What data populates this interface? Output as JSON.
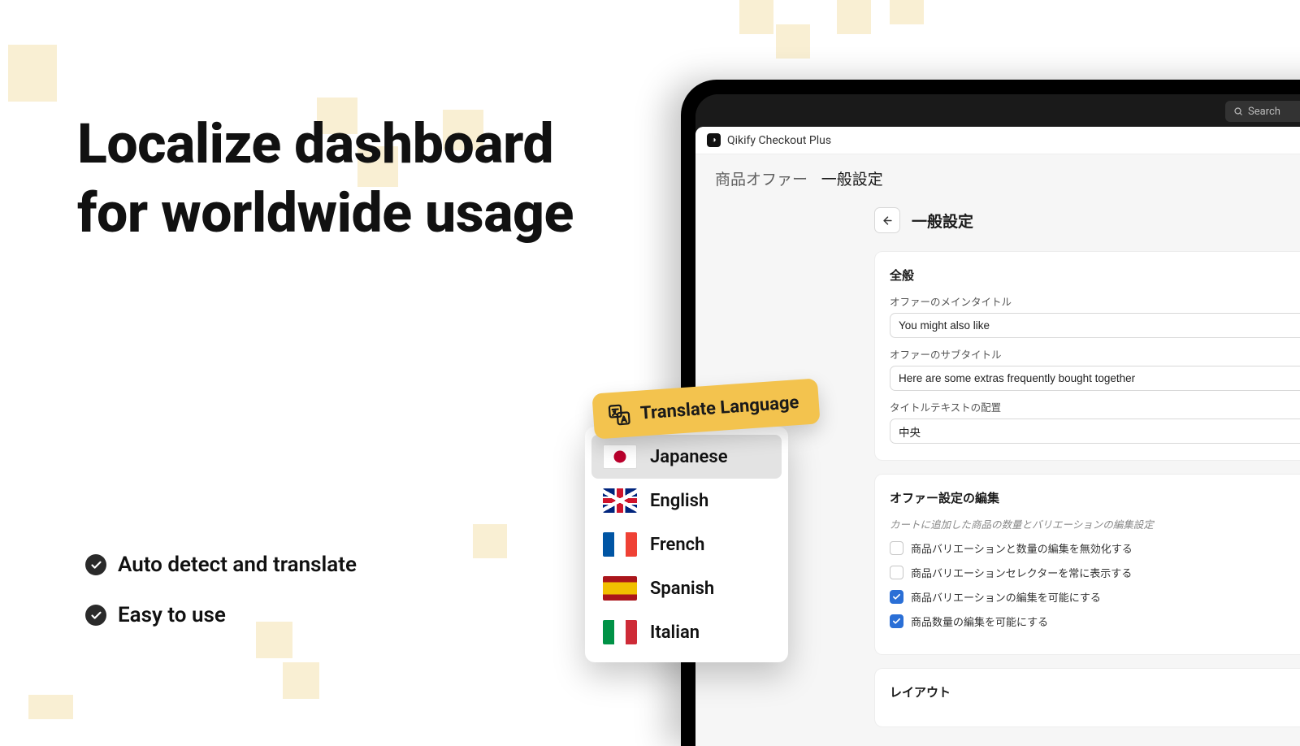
{
  "headline": "Localize dashboard for worldwide usage",
  "bullets": [
    "Auto detect and translate",
    "Easy to use"
  ],
  "translate_tag": "Translate Language",
  "languages": [
    {
      "name": "Japanese",
      "flag": "jp",
      "selected": true
    },
    {
      "name": "English",
      "flag": "uk",
      "selected": false
    },
    {
      "name": "French",
      "flag": "fr",
      "selected": false
    },
    {
      "name": "Spanish",
      "flag": "es",
      "selected": false
    },
    {
      "name": "Italian",
      "flag": "it",
      "selected": false
    }
  ],
  "app": {
    "name": "Qikify Checkout Plus",
    "search_placeholder": "Search",
    "breadcrumb": {
      "parent": "商品オファー",
      "current": "一般設定"
    },
    "page_title": "一般設定",
    "card_general": {
      "title": "全般",
      "main_title_label": "オファーのメインタイトル",
      "main_title_value": "You might also like",
      "sub_title_label": "オファーのサブタイトル",
      "sub_title_value": "Here are some extras frequently bought together",
      "align_label": "タイトルテキストの配置",
      "align_value": "中央"
    },
    "card_edit": {
      "title": "オファー設定の編集",
      "helper": "カートに追加した商品の数量とバリエーションの編集設定",
      "options": [
        {
          "label": "商品バリエーションと数量の編集を無効化する",
          "checked": false
        },
        {
          "label": "商品バリエーションセレクターを常に表示する",
          "checked": false
        },
        {
          "label": "商品バリエーションの編集を可能にする",
          "checked": true
        },
        {
          "label": "商品数量の編集を可能にする",
          "checked": true
        }
      ]
    },
    "card_layout_title": "レイアウト"
  }
}
